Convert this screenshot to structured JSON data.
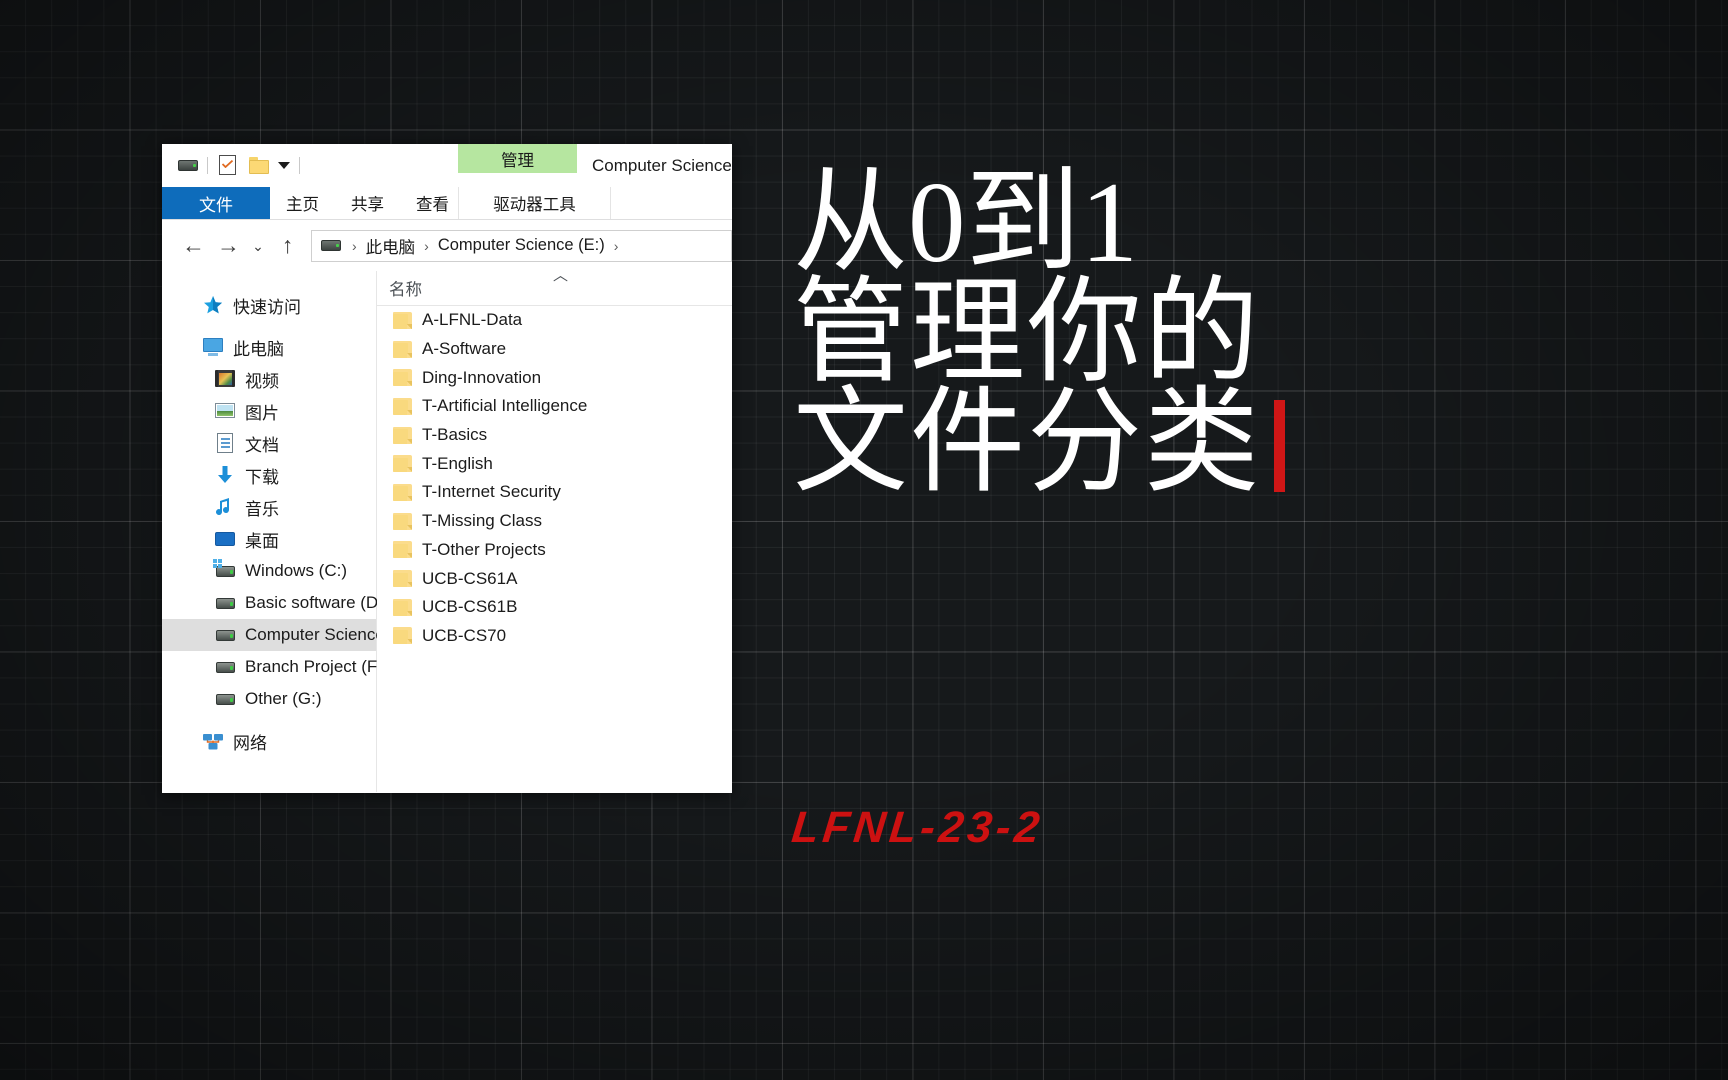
{
  "background": {
    "color": "#16191b",
    "grid_minor_color": "rgba(255,255,255,0.055)",
    "grid_major_color": "rgba(255,255,255,0.14)"
  },
  "headline": {
    "line1": "从0到1",
    "line2": "管理你的",
    "line3": "文件分类",
    "caret_color": "#d01616",
    "color": "#ffffff"
  },
  "subtitle": {
    "text": "LFNL-23-2",
    "color": "#cc1111"
  },
  "explorer": {
    "window_title": "Computer Science",
    "quick_access_toolbar": {
      "drive_icon": "drive-icon",
      "properties_icon": "properties-icon",
      "new_folder_icon": "new-folder-icon",
      "customize_icon": "chevron-down-icon"
    },
    "contextual_tab_group": "管理",
    "ribbon_tabs": [
      {
        "label": "文件",
        "active": true
      },
      {
        "label": "主页",
        "active": false
      },
      {
        "label": "共享",
        "active": false
      },
      {
        "label": "查看",
        "active": false
      }
    ],
    "contextual_tab": "驱动器工具",
    "nav": {
      "back_icon": "arrow-left-icon",
      "forward_icon": "arrow-right-icon",
      "recent_icon": "chevron-down-icon",
      "up_icon": "arrow-up-icon"
    },
    "breadcrumb": {
      "icon": "drive-icon",
      "items": [
        "此电脑",
        "Computer Science (E:)"
      ],
      "separator": "›",
      "trailing_separator": "›"
    },
    "sidebar": {
      "groups": [
        {
          "items": [
            {
              "label": "快速访问",
              "icon": "star-icon",
              "indent": false,
              "selected": false
            }
          ]
        },
        {
          "items": [
            {
              "label": "此电脑",
              "icon": "this-pc-icon",
              "indent": false,
              "selected": false
            },
            {
              "label": "视频",
              "icon": "videos-icon",
              "indent": true,
              "selected": false
            },
            {
              "label": "图片",
              "icon": "pictures-icon",
              "indent": true,
              "selected": false
            },
            {
              "label": "文档",
              "icon": "documents-icon",
              "indent": true,
              "selected": false
            },
            {
              "label": "下载",
              "icon": "downloads-icon",
              "indent": true,
              "selected": false
            },
            {
              "label": "音乐",
              "icon": "music-icon",
              "indent": true,
              "selected": false
            },
            {
              "label": "桌面",
              "icon": "desktop-icon",
              "indent": true,
              "selected": false
            },
            {
              "label": "Windows (C:)",
              "icon": "windows-drive-icon",
              "indent": true,
              "selected": false
            },
            {
              "label": "Basic software (D",
              "icon": "drive-icon",
              "indent": true,
              "selected": false
            },
            {
              "label": "Computer Science",
              "icon": "drive-icon",
              "indent": true,
              "selected": true
            },
            {
              "label": "Branch Project (F:",
              "icon": "drive-icon",
              "indent": true,
              "selected": false
            },
            {
              "label": "Other (G:)",
              "icon": "drive-icon",
              "indent": true,
              "selected": false
            }
          ]
        },
        {
          "items": [
            {
              "label": "网络",
              "icon": "network-icon",
              "indent": false,
              "selected": false
            }
          ]
        }
      ]
    },
    "file_list": {
      "column_header": "名称",
      "sort_indicator": "caret-up-icon",
      "rows": [
        {
          "name": "A-LFNL-Data",
          "icon": "folder-icon"
        },
        {
          "name": "A-Software",
          "icon": "folder-icon"
        },
        {
          "name": "Ding-Innovation",
          "icon": "folder-icon"
        },
        {
          "name": "T-Artificial Intelligence",
          "icon": "folder-icon"
        },
        {
          "name": "T-Basics",
          "icon": "folder-icon"
        },
        {
          "name": "T-English",
          "icon": "folder-icon"
        },
        {
          "name": "T-Internet Security",
          "icon": "folder-icon"
        },
        {
          "name": "T-Missing Class",
          "icon": "folder-icon"
        },
        {
          "name": "T-Other Projects",
          "icon": "folder-icon"
        },
        {
          "name": "UCB-CS61A",
          "icon": "folder-icon"
        },
        {
          "name": "UCB-CS61B",
          "icon": "folder-icon"
        },
        {
          "name": "UCB-CS70",
          "icon": "folder-icon"
        }
      ]
    }
  }
}
